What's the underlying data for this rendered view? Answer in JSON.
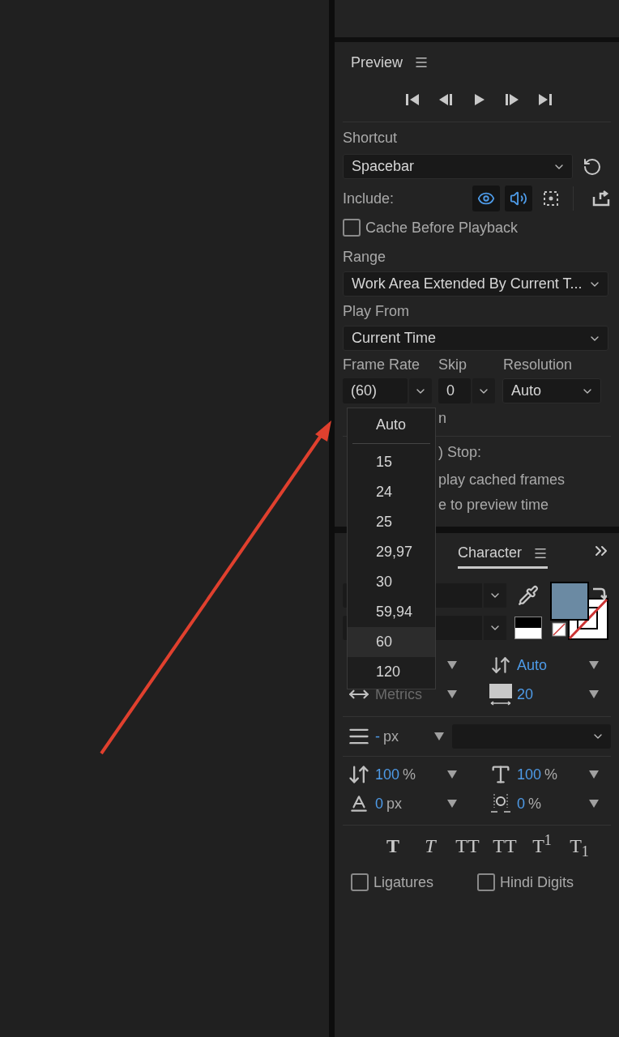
{
  "preview": {
    "title": "Preview",
    "shortcut": {
      "label": "Shortcut",
      "value": "Spacebar"
    },
    "include": {
      "label": "Include:",
      "video": true,
      "audio": true,
      "overlays": false
    },
    "cache": {
      "label": "Cache Before Playback",
      "checked": false
    },
    "range": {
      "label": "Range",
      "value": "Work Area Extended By Current T..."
    },
    "play_from": {
      "label": "Play From",
      "value": "Current Time"
    },
    "frame_rate": {
      "label": "Frame Rate",
      "value": "(60)"
    },
    "skip": {
      "label": "Skip",
      "value": "0"
    },
    "resolution": {
      "label": "Resolution",
      "value": "Auto"
    },
    "hidden_texts": [
      "n",
      ") Stop:",
      "play cached frames",
      "e to preview time"
    ]
  },
  "frame_rate_menu": [
    {
      "kind": "item",
      "label": "Auto",
      "selected": false
    },
    {
      "kind": "separator"
    },
    {
      "kind": "item",
      "label": "15",
      "selected": false
    },
    {
      "kind": "item",
      "label": "24",
      "selected": false
    },
    {
      "kind": "item",
      "label": "25",
      "selected": false
    },
    {
      "kind": "item",
      "label": "29,97",
      "selected": false
    },
    {
      "kind": "item",
      "label": "30",
      "selected": false
    },
    {
      "kind": "item",
      "label": "59,94",
      "selected": false
    },
    {
      "kind": "item",
      "label": "60",
      "selected": true
    },
    {
      "kind": "item",
      "label": "120",
      "selected": false
    }
  ],
  "character": {
    "tab": "Character",
    "rows": [
      {
        "right": {
          "value": "Auto"
        }
      },
      {
        "left": {
          "value": "Metrics",
          "disabled": true
        },
        "right": {
          "value": "20",
          "disabled": false
        }
      }
    ],
    "stroke": {
      "value": "-",
      "unit": "px"
    },
    "scale_rows": [
      {
        "left": {
          "value": "100",
          "unit": "%"
        },
        "right": {
          "value": "100",
          "unit": "%"
        }
      },
      {
        "left": {
          "value": "0",
          "unit": "px"
        },
        "right": {
          "value": "0",
          "unit": "%"
        }
      }
    ],
    "style_buttons": [
      {
        "kind": "bold",
        "label": "T"
      },
      {
        "kind": "italic",
        "label": "T"
      },
      {
        "kind": "caps",
        "label": "TT"
      },
      {
        "kind": "small_caps",
        "label": "TT"
      },
      {
        "kind": "super",
        "label": "T$^{1}$"
      },
      {
        "kind": "sub",
        "label": "T$_{1}$"
      }
    ],
    "checkboxes": [
      {
        "label": "Ligatures",
        "checked": false
      },
      {
        "label": "Hindi Digits",
        "checked": false
      }
    ]
  }
}
